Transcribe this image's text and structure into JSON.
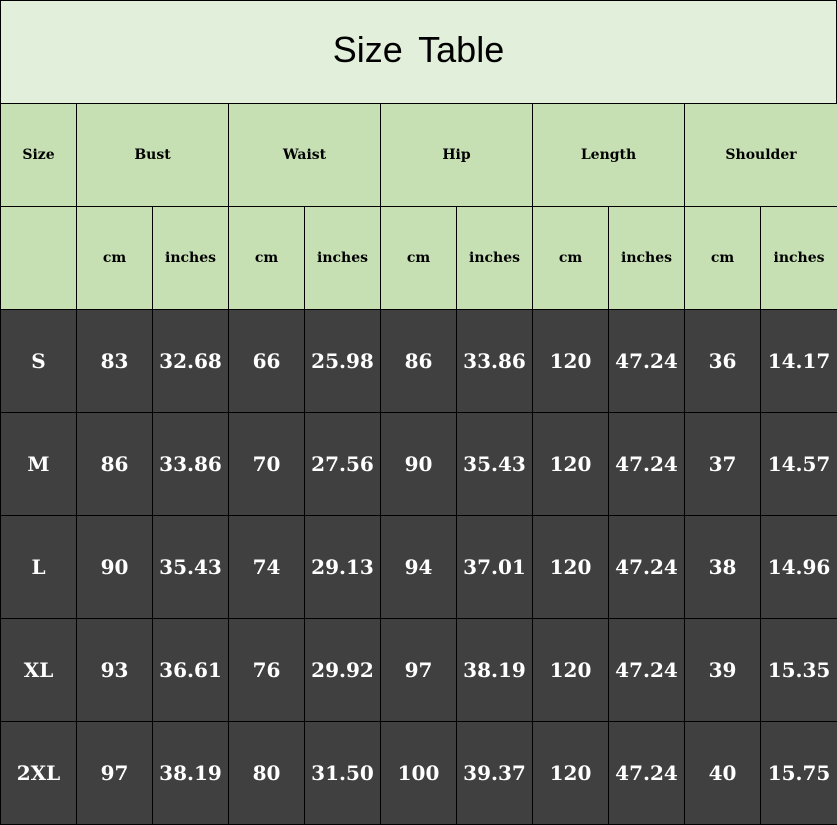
{
  "title": "Size  Table",
  "colors": {
    "title_bg": "#e2efda",
    "header_bg": "#c6e0b4",
    "body_bg": "#404040",
    "body_text": "#ffffff"
  },
  "headers": {
    "size": "Size",
    "groups": [
      "Bust",
      "Waist",
      "Hip",
      "Length",
      "Shoulder"
    ]
  },
  "units": [
    "cm",
    "inches",
    "cm",
    "inches",
    "cm",
    "inches",
    "cm",
    "inches",
    "cm",
    "inches"
  ],
  "rows": [
    {
      "size": "S",
      "values": [
        "83",
        "32.68",
        "66",
        "25.98",
        "86",
        "33.86",
        "120",
        "47.24",
        "36",
        "14.17"
      ]
    },
    {
      "size": "M",
      "values": [
        "86",
        "33.86",
        "70",
        "27.56",
        "90",
        "35.43",
        "120",
        "47.24",
        "37",
        "14.57"
      ]
    },
    {
      "size": "L",
      "values": [
        "90",
        "35.43",
        "74",
        "29.13",
        "94",
        "37.01",
        "120",
        "47.24",
        "38",
        "14.96"
      ]
    },
    {
      "size": "XL",
      "values": [
        "93",
        "36.61",
        "76",
        "29.92",
        "97",
        "38.19",
        "120",
        "47.24",
        "39",
        "15.35"
      ]
    },
    {
      "size": "2XL",
      "values": [
        "97",
        "38.19",
        "80",
        "31.50",
        "100",
        "39.37",
        "120",
        "47.24",
        "40",
        "15.75"
      ]
    }
  ]
}
